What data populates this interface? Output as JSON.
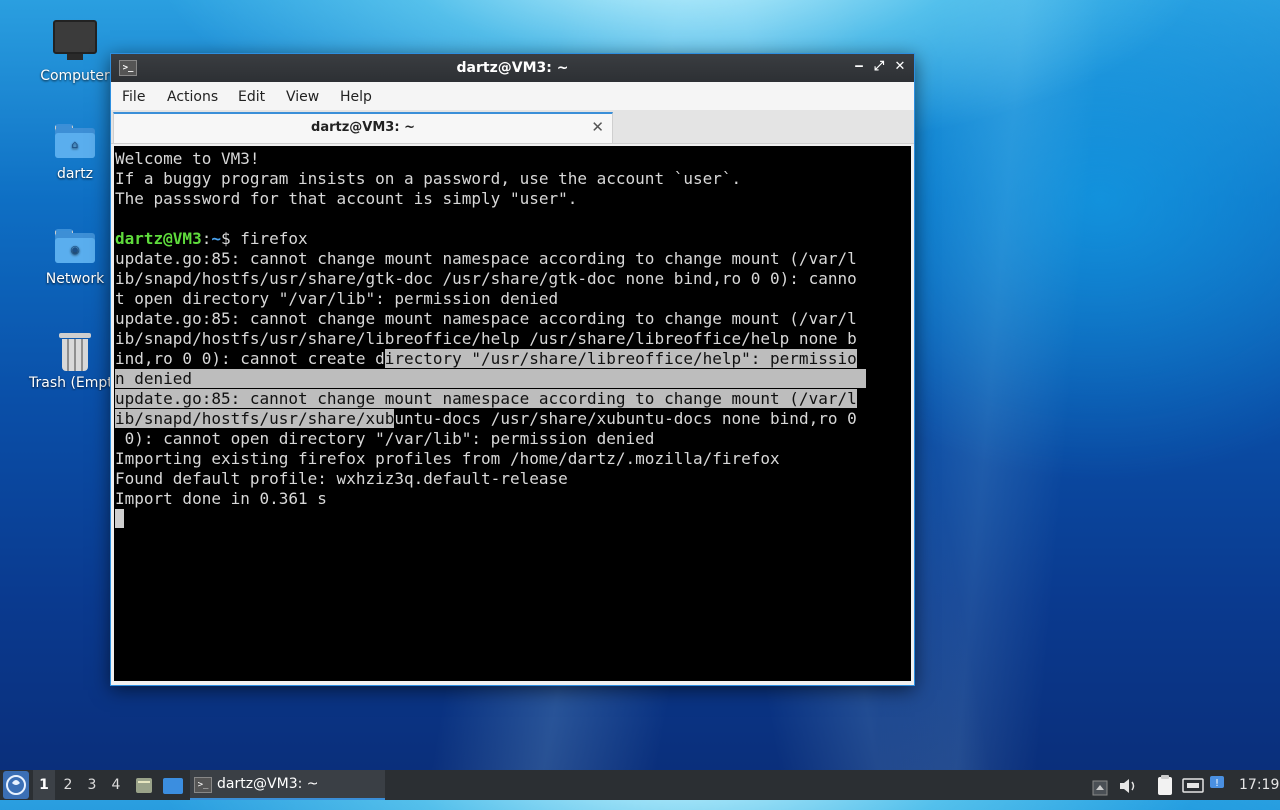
{
  "desktop": {
    "icons": [
      {
        "label": "Computer"
      },
      {
        "label": "dartz"
      },
      {
        "label": "Network"
      },
      {
        "label": "Trash (Empty)"
      }
    ]
  },
  "window": {
    "title": "dartz@VM3: ~",
    "app_icon": ">_",
    "controls": {
      "minimize": "‒",
      "maximize": "⤢",
      "close": "✕"
    }
  },
  "menu": [
    "File",
    "Actions",
    "Edit",
    "View",
    "Help"
  ],
  "tab": {
    "label": "dartz@VM3: ~",
    "close": "✕"
  },
  "terminal": {
    "welcome": [
      "Welcome to VM3!",
      "If a buggy program insists on a password, use the account `user`.",
      "The passsword for that account is simply \"user\"."
    ],
    "prompt": {
      "user_host": "dartz@VM3",
      "sep": ":",
      "path": "~",
      "symbol": "$",
      "command": " firefox"
    },
    "output": [
      {
        "text": "update.go:85: cannot change mount namespace according to change mount (/var/l",
        "sel": ""
      },
      {
        "text": "ib/snapd/hostfs/usr/share/gtk-doc /usr/share/gtk-doc none bind,ro 0 0): canno",
        "sel": ""
      },
      {
        "text": "t open directory \"/var/lib\": permission denied",
        "sel": ""
      },
      {
        "text": "update.go:85: cannot change mount namespace according to change mount (/var/l",
        "sel": ""
      },
      {
        "text": "ib/snapd/hostfs/usr/share/libreoffice/help /usr/share/libreoffice/help none b",
        "sel": ""
      },
      {
        "text": "ind,ro 0 0): cannot create d",
        "sel": "irectory \"/usr/share/libreoffice/help\": permissio"
      },
      {
        "text": "",
        "sel": "n denied                                                                      "
      },
      {
        "text": "",
        "sel": "update.go:85: cannot change mount namespace according to change mount (/var/l"
      },
      {
        "text": "",
        "sel": "ib/snapd/hostfs/usr/share/xub",
        "after": "untu-docs /usr/share/xubuntu-docs none bind,ro 0"
      },
      {
        "text": " 0): cannot open directory \"/var/lib\": permission denied",
        "sel": ""
      },
      {
        "text": "Importing existing firefox profiles from /home/dartz/.mozilla/firefox",
        "sel": ""
      },
      {
        "text": "Found default profile: wxhziz3q.default-release",
        "sel": ""
      },
      {
        "text": "Import done in 0.361 s",
        "sel": ""
      }
    ]
  },
  "taskbar": {
    "workspaces": [
      "1",
      "2",
      "3",
      "4"
    ],
    "active_workspace": "1",
    "task_label": "dartz@VM3: ~",
    "clock": "17:19"
  }
}
